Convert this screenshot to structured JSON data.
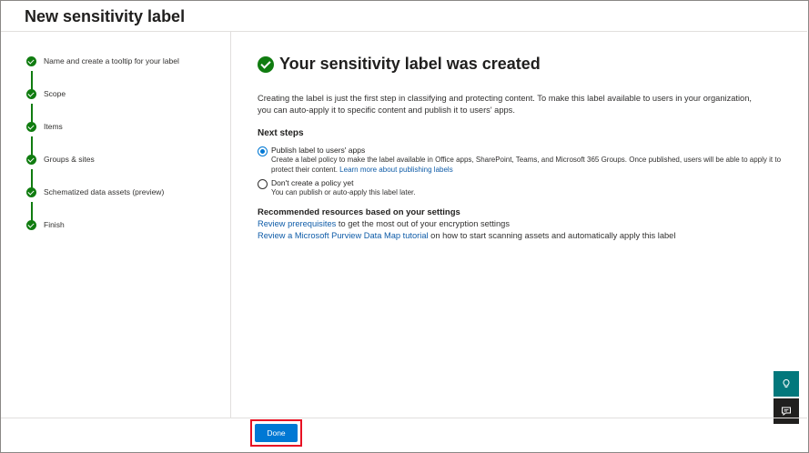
{
  "header": {
    "title": "New sensitivity label"
  },
  "steps": [
    {
      "label": "Name and create a tooltip for your label",
      "status": "complete"
    },
    {
      "label": "Scope",
      "status": "complete"
    },
    {
      "label": "Items",
      "status": "complete"
    },
    {
      "label": "Groups & sites",
      "status": "complete"
    },
    {
      "label": "Schematized data assets (preview)",
      "status": "complete"
    },
    {
      "label": "Finish",
      "status": "complete"
    }
  ],
  "main": {
    "heading": "Your sensitivity label was created",
    "description": "Creating the label is just the first step in classifying and protecting content. To make this label available to users in your organization, you can auto-apply it to specific content and publish it to users' apps.",
    "next_steps_title": "Next steps",
    "options": [
      {
        "title": "Publish label to users' apps",
        "description": "Create a label policy to make the label available in Office apps, SharePoint, Teams, and Microsoft 365 Groups. Once published, users will be able to apply it to protect their content.",
        "link": "Learn more about publishing labels",
        "selected": true
      },
      {
        "title": "Don't create a policy yet",
        "description": "You can publish or auto-apply this label later.",
        "selected": false
      }
    ],
    "resources_title": "Recommended resources based on your settings",
    "resources": [
      {
        "link": "Review prerequisites",
        "text": " to get the most out of your encryption settings"
      },
      {
        "link": "Review a Microsoft Purview Data Map tutorial",
        "text": " on how to start scanning assets and automatically apply this label"
      }
    ]
  },
  "footer": {
    "done_label": "Done"
  },
  "side_buttons": {
    "help_icon": "lightbulb-icon",
    "feedback_icon": "feedback-icon"
  },
  "colors": {
    "accent": "#0078d4",
    "success": "#107c10",
    "highlight": "#e81123",
    "help_bg": "#03787c"
  }
}
